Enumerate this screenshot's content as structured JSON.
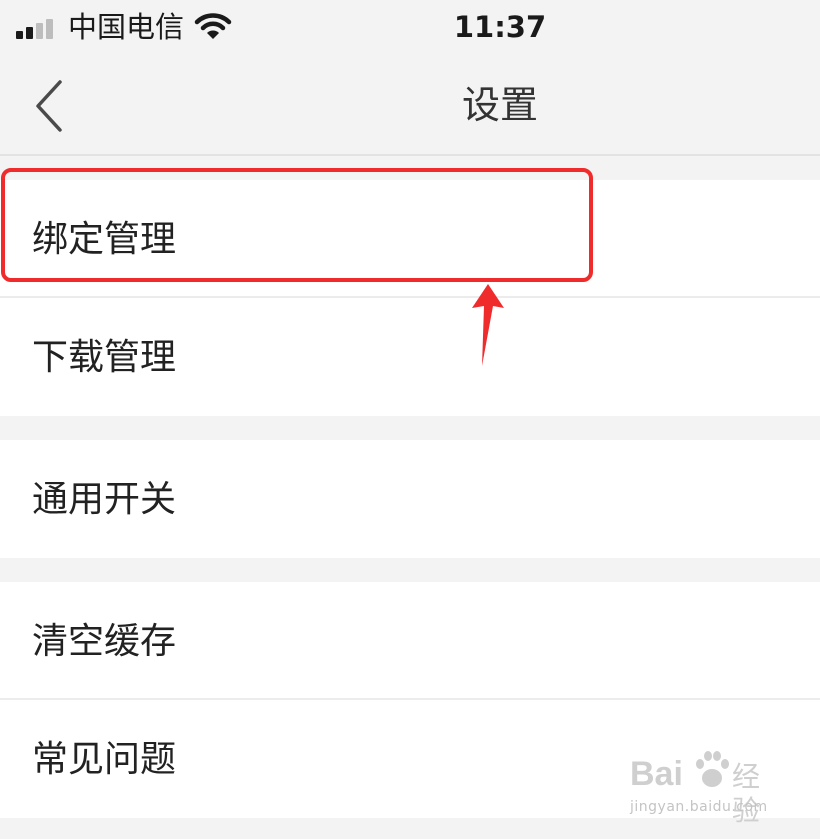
{
  "status_bar": {
    "carrier": "中国电信",
    "time": "11:37",
    "signal_icon": "signal-bars-icon",
    "wifi_icon": "wifi-icon"
  },
  "nav_bar": {
    "title": "设置",
    "back_icon": "chevron-left-icon"
  },
  "settings": {
    "items": [
      {
        "label": "绑定管理"
      },
      {
        "label": "下载管理"
      },
      {
        "label": "通用开关"
      },
      {
        "label": "清空缓存"
      },
      {
        "label": "常见问题"
      }
    ]
  },
  "annotation": {
    "color": "#ef2b2b"
  },
  "watermark": {
    "logo": "Bai",
    "brand": "经验",
    "url": "jingyan.baidu.com"
  },
  "colors": {
    "background": "#f3f3f3",
    "row_background": "#ffffff",
    "text": "#222222"
  }
}
